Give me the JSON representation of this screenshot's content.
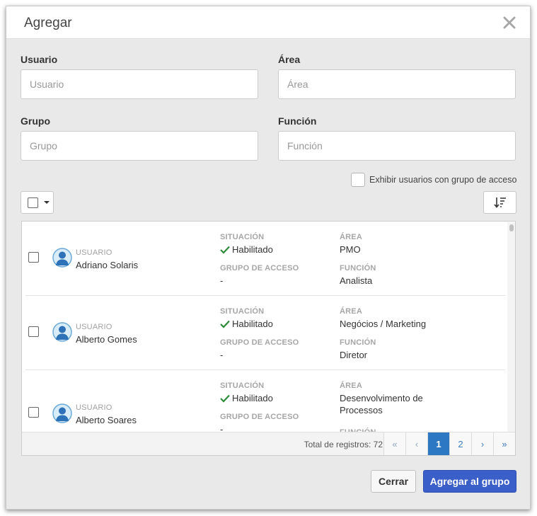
{
  "dialog": {
    "title": "Agregar"
  },
  "filters": {
    "usuario": {
      "label": "Usuario",
      "placeholder": "Usuario"
    },
    "area": {
      "label": "Área",
      "placeholder": "Área"
    },
    "grupo": {
      "label": "Grupo",
      "placeholder": "Grupo"
    },
    "funcion": {
      "label": "Función",
      "placeholder": "Función"
    },
    "show_with_group": "Exhibir usuarios con grupo de acceso"
  },
  "list": {
    "labels": {
      "user": "USUARIO",
      "status": "SITUACIÓN",
      "access_group": "GRUPO DE ACCESO",
      "area": "ÁREA",
      "role": "FUNCIÓN"
    },
    "rows": [
      {
        "name": "Adriano Solaris",
        "status": "Habilitado",
        "access_group": "-",
        "area": "PMO",
        "role": "Analista"
      },
      {
        "name": "Alberto Gomes",
        "status": "Habilitado",
        "access_group": "-",
        "area": "Negócios / Marketing",
        "role": "Diretor"
      },
      {
        "name": "Alberto Soares",
        "status": "Habilitado",
        "access_group": "-",
        "area": "Desenvolvimento de Processos",
        "role": ""
      }
    ],
    "total": "Total de registros: 72"
  },
  "pager": {
    "first": "«",
    "prev": "‹",
    "page1": "1",
    "page2": "2",
    "next": "›",
    "last": "»",
    "current": 1
  },
  "buttons": {
    "close": "Cerrar",
    "add": "Agregar al grupo"
  },
  "colors": {
    "primary": "#3b5fc9",
    "active_page": "#2d78c2",
    "status_check": "#2e8b3a"
  }
}
